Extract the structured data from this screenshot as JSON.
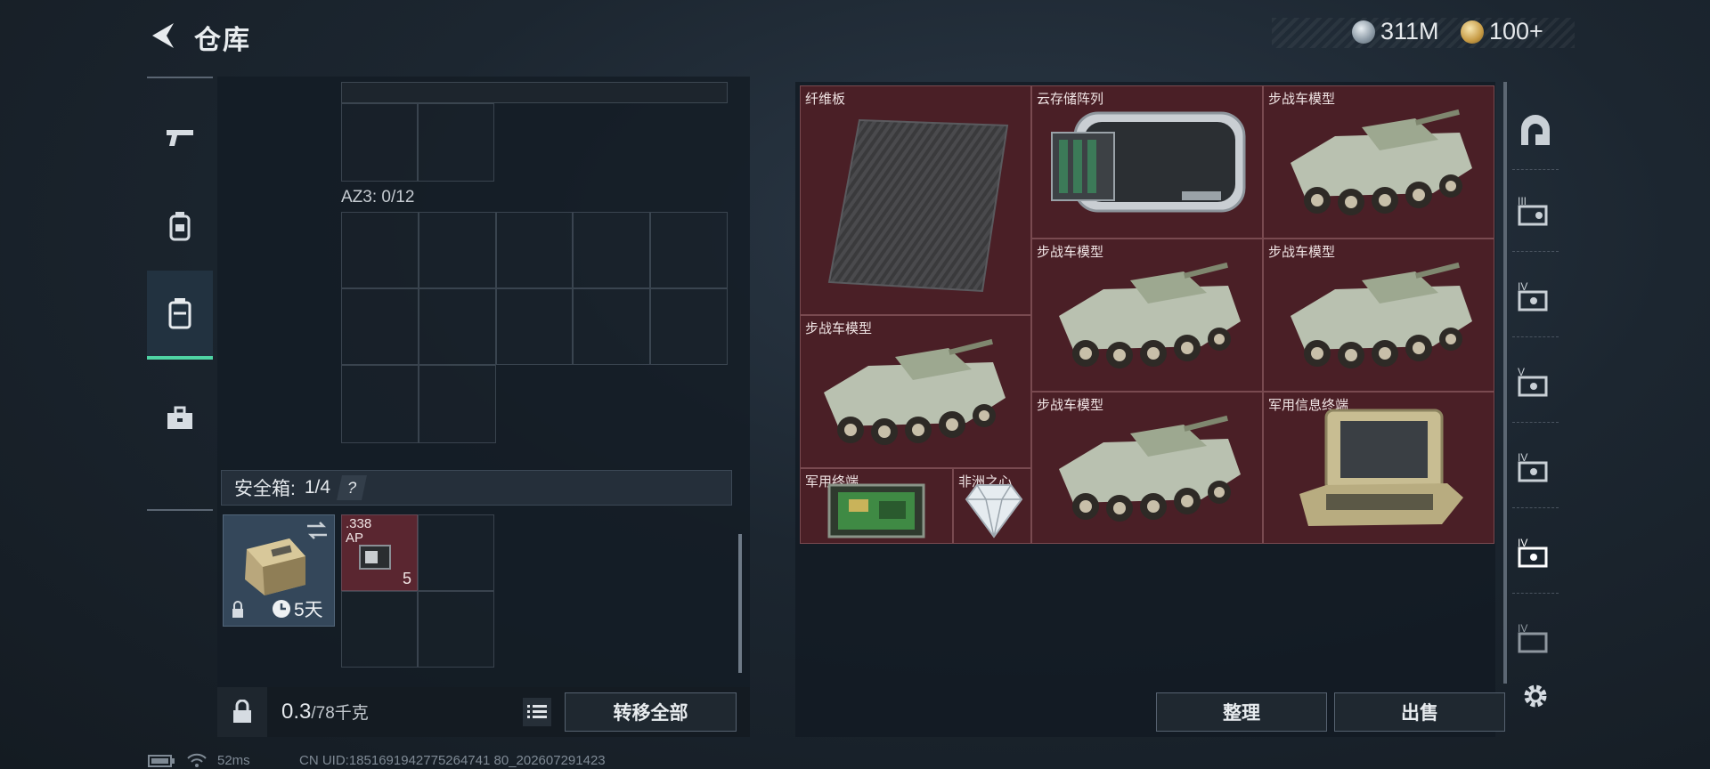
{
  "header": {
    "title": "仓库",
    "currency": [
      {
        "icon": "silver-coin-icon",
        "amount": "311M"
      },
      {
        "icon": "gold-coin-icon",
        "amount": "100+"
      }
    ]
  },
  "left_rail": [
    {
      "name": "weapons",
      "icon": "pistol-icon",
      "active": false
    },
    {
      "name": "gear",
      "icon": "backpack-gear-icon",
      "active": false
    },
    {
      "name": "storage",
      "icon": "locker-icon",
      "active": true
    },
    {
      "name": "supplies",
      "icon": "briefcase-icon",
      "active": false
    }
  ],
  "inventory": {
    "section_label": "AZ3: 0/12",
    "safe_box": {
      "label": "安全箱:",
      "count": "1/4",
      "help": "?",
      "case_timer": "5天",
      "item": {
        "name": ".338 AP",
        "qty": "5"
      }
    },
    "weight": {
      "current": "0.3",
      "max": "/78千克"
    },
    "transfer_all": "转移全部"
  },
  "stash": {
    "items": [
      {
        "name": "纤维板",
        "kind": "carbon-plate"
      },
      {
        "name": "云存储阵列",
        "kind": "storage-array"
      },
      {
        "name": "步战车模型",
        "kind": "ifv-model"
      },
      {
        "name": "步战车模型",
        "kind": "ifv-model"
      },
      {
        "name": "步战车模型",
        "kind": "ifv-model"
      },
      {
        "name": "步战车模型",
        "kind": "ifv-model"
      },
      {
        "name": "步战车模型",
        "kind": "ifv-model"
      },
      {
        "name": "军用信息终端",
        "kind": "military-terminal"
      },
      {
        "name": "军用终端",
        "kind": "circuit-board"
      },
      {
        "name": "非洲之心",
        "kind": "diamond"
      }
    ],
    "sort_button": "整理",
    "sell_button": "出售"
  },
  "right_tabs": [
    "arch-tab",
    "tab-III",
    "tab-IV",
    "tab-V",
    "tab-IV-b",
    "tab-IV-active",
    "tab-IV-c"
  ],
  "status_bar": {
    "ping": "52ms",
    "uid": "CN UID:1851691942775264741 80_202607291423"
  },
  "colors": {
    "accent": "#4fd4a4",
    "item_bg": "#4a1f26",
    "panel_bg": "#141c24"
  }
}
